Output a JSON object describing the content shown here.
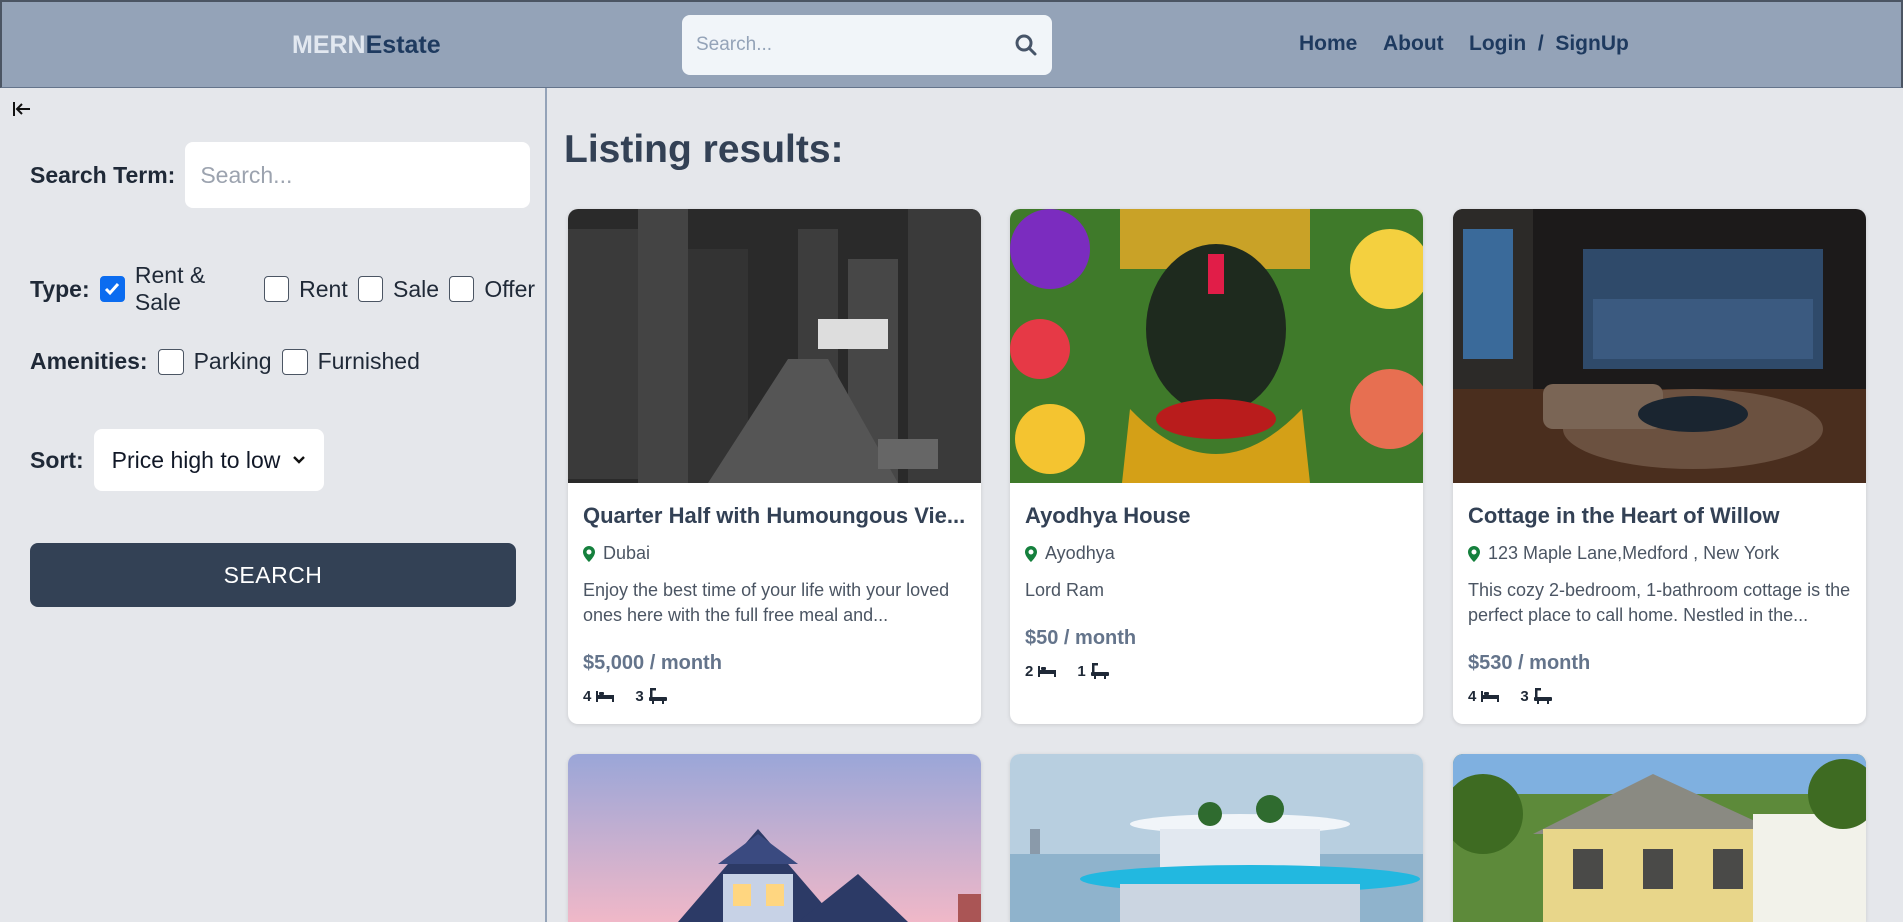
{
  "header": {
    "logo_part1": "MERN",
    "logo_part2": "Estate",
    "search_placeholder": "Search...",
    "nav_home": "Home",
    "nav_about": "About",
    "nav_login": "Login  /  SignUp"
  },
  "sidebar": {
    "search_term_label": "Search Term:",
    "search_term_placeholder": "Search...",
    "type_label": "Type:",
    "type_options": [
      {
        "label": "Rent & Sale",
        "checked": true
      },
      {
        "label": "Rent",
        "checked": false
      },
      {
        "label": "Sale",
        "checked": false
      },
      {
        "label": "Offer",
        "checked": false
      }
    ],
    "amenities_label": "Amenities:",
    "amenities_options": [
      {
        "label": "Parking",
        "checked": false
      },
      {
        "label": "Furnished",
        "checked": false
      }
    ],
    "sort_label": "Sort:",
    "sort_value": "Price high to low",
    "search_button": "SEARCH"
  },
  "main": {
    "results_title": "Listing results:",
    "listings": [
      {
        "title": "Quarter Half with Humoungous Vie...",
        "location": "Dubai",
        "description": "Enjoy the best time of your life with your loved ones here with the full free meal and...",
        "price": "$5,000 / month",
        "beds": "4",
        "baths": "3"
      },
      {
        "title": "Ayodhya House",
        "location": "Ayodhya",
        "description": "Lord Ram",
        "price": "$50 / month",
        "beds": "2",
        "baths": "1"
      },
      {
        "title": "Cottage in the Heart of Willow",
        "location": "123 Maple Lane,Medford , New York",
        "description": "This cozy 2-bedroom, 1-bathroom cottage is the perfect place to call home. Nestled in the...",
        "price": "$530 / month",
        "beds": "4",
        "baths": "3"
      }
    ]
  },
  "colors": {
    "header_bg": "#94a3b8",
    "page_bg": "#e5e7eb",
    "button_bg": "#334155",
    "location_icon": "#15803d",
    "checkbox_checked": "#0b6cf0"
  }
}
